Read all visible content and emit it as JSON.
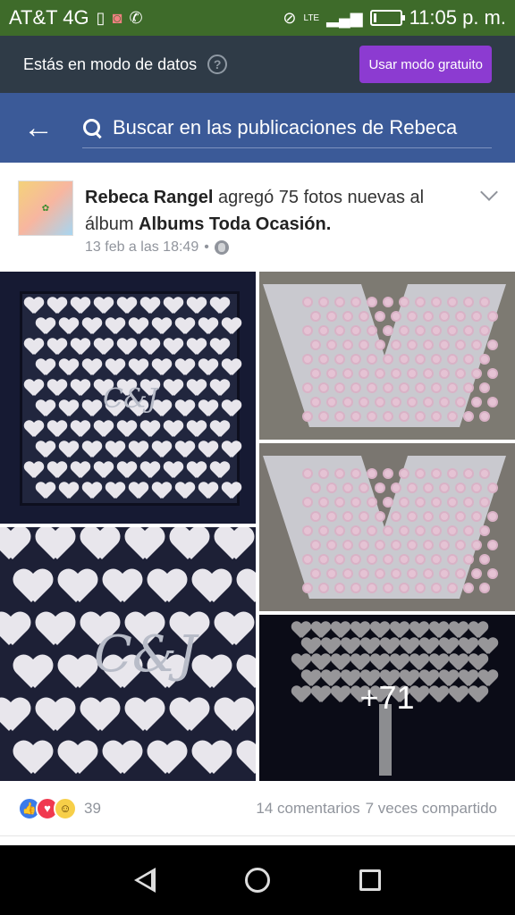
{
  "status_bar": {
    "carrier": "AT&T 4G",
    "network": "LTE",
    "time": "11:05 p. m.",
    "icons": [
      "sim-icon",
      "messenger-icon",
      "whatsapp-icon",
      "vibrate-icon",
      "signal-icon",
      "battery-icon"
    ],
    "battery_level": 0.1
  },
  "data_banner": {
    "text": "Estás en modo de datos",
    "help": "?",
    "button_label": "Usar modo gratuito",
    "button_color": "#8c3bd1"
  },
  "header": {
    "back": "←",
    "search_placeholder": "Buscar en las publicaciones de Rebeca",
    "color": "#3b5a98"
  },
  "post": {
    "author": "Rebeca Rangel",
    "action_text": " agregó 75 fotos nuevas al álbum ",
    "album": "Albums Toda Ocasión.",
    "timestamp": "13 feb a las 18:49",
    "separator": "•",
    "more_photos_label": "+71",
    "reactions_count": "39",
    "comments": "14 comentarios",
    "shares": "7 veces compartido",
    "reaction_icons": [
      "like-icon",
      "love-icon",
      "wow-icon"
    ]
  },
  "nav": {
    "buttons": [
      "back-icon",
      "home-icon",
      "recents-icon"
    ]
  }
}
